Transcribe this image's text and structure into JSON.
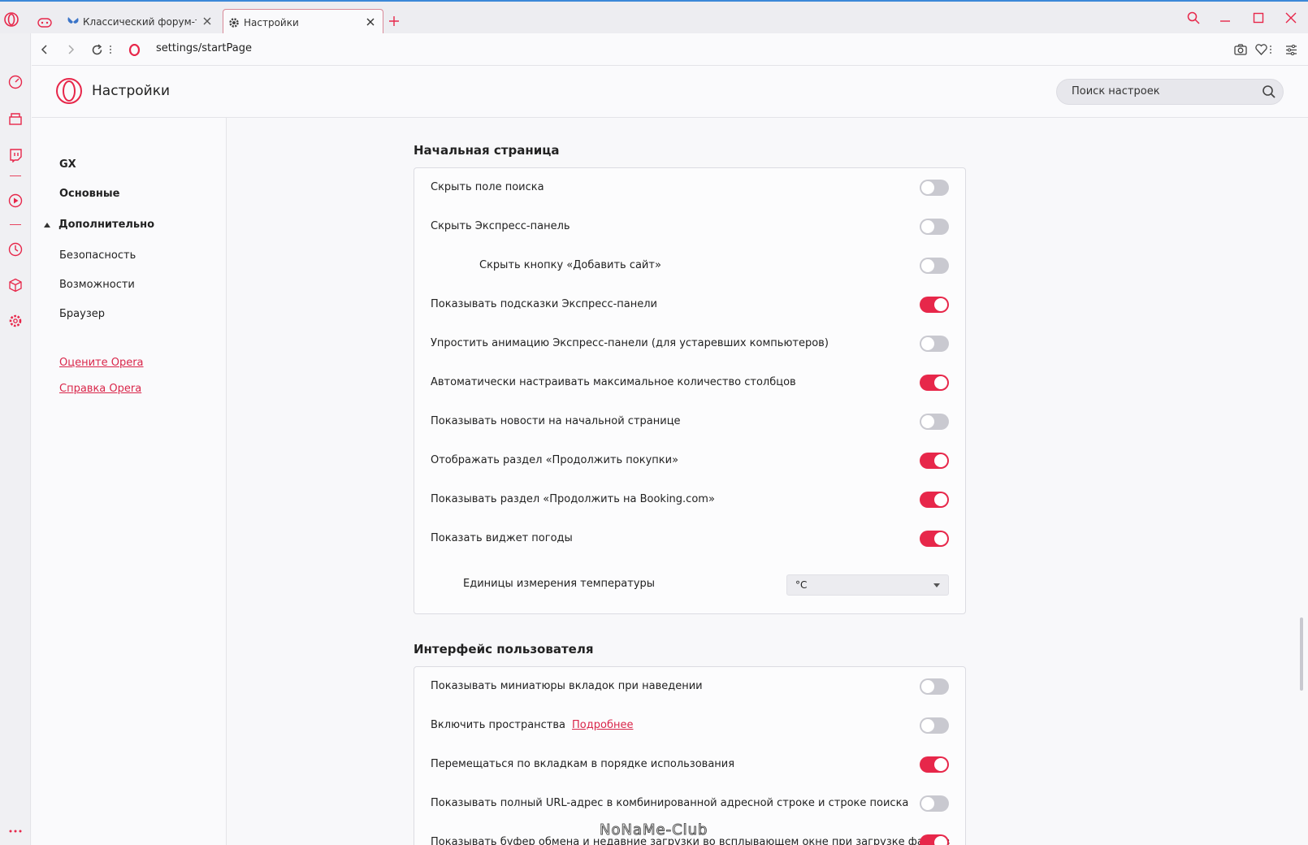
{
  "tabs": [
    {
      "label": "Классический форум-тре",
      "active": false
    },
    {
      "label": "Настройки",
      "active": true
    }
  ],
  "address": {
    "url": "settings/startPage"
  },
  "header": {
    "title": "Настройки",
    "search_placeholder": "Поиск настроек"
  },
  "nav": {
    "items": [
      "GX",
      "Основные",
      "Дополнительно",
      "Безопасность",
      "Возможности",
      "Браузер"
    ],
    "links": [
      "Оцените Opera",
      "Справка Opera"
    ]
  },
  "sections": [
    {
      "title": "Начальная страница",
      "rows": [
        {
          "label": "Скрыть поле поиска",
          "on": false
        },
        {
          "label": "Скрыть Экспресс-панель",
          "on": false
        },
        {
          "label": "Скрыть кнопку «Добавить сайт»",
          "on": false,
          "indent": true
        },
        {
          "label": "Показывать подсказки Экспресс-панели",
          "on": true
        },
        {
          "label": "Упростить анимацию Экспресс-панели (для устаревших компьютеров)",
          "on": false
        },
        {
          "label": "Автоматически настраивать максимальное количество столбцов",
          "on": true
        },
        {
          "label": "Показывать новости на начальной странице",
          "on": false
        },
        {
          "label": "Отображать раздел «Продолжить покупки»",
          "on": true
        },
        {
          "label": "Показывать раздел «Продолжить на Booking.com»",
          "on": true
        },
        {
          "label": "Показать виджет погоды",
          "on": true
        }
      ],
      "select_row": {
        "label": "Единицы измерения температуры",
        "value": "°C"
      }
    },
    {
      "title": "Интерфейс пользователя",
      "rows": [
        {
          "label": "Показывать миниатюры вкладок при наведении",
          "on": false
        },
        {
          "label": "Включить пространства",
          "link": "Подробнее",
          "on": false
        },
        {
          "label": "Перемещаться по вкладкам в порядке использования",
          "on": true
        },
        {
          "label": "Показывать полный URL-адрес в комбинированной адресной строке и строке поиска",
          "on": false
        },
        {
          "label": "Показывать буфер обмена и недавние загрузки во всплывающем окне при загрузке файлов",
          "on": true
        }
      ]
    }
  ],
  "watermark": "NoNaMe-Club",
  "colors": {
    "accent": "#e7274a",
    "link": "#d9264a",
    "toggle_off": "#c9c9d0"
  }
}
